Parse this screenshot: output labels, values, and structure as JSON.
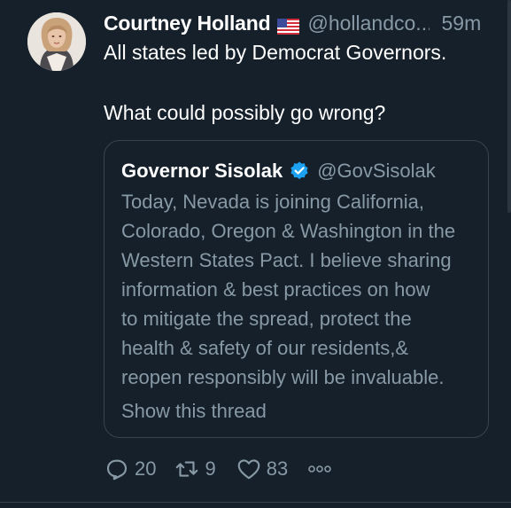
{
  "tweet": {
    "author_name": "Courtney Holland",
    "author_flag": "us-flag-icon",
    "author_handle": "@hollandco...",
    "time_ago": "59m",
    "text_line1": "All states led by Democrat Governors.",
    "text_line2": "What could possibly go wrong?"
  },
  "quote": {
    "author_name": "Governor Sisolak",
    "verified": true,
    "author_handle": "@GovSisolak",
    "body_lines": [
      "Today, Nevada is joining California,",
      "Colorado, Oregon & Washington in the",
      "Western States Pact. I believe sharing",
      "information & best practices on how",
      "to mitigate the spread, protect the",
      "health & safety of our residents,&",
      "reopen responsibly  will be invaluable."
    ],
    "show_thread": "Show this thread"
  },
  "actions": {
    "reply_count": "20",
    "retweet_count": "9",
    "like_count": "83",
    "more_icon": "more-icon"
  },
  "colors": {
    "background": "#15202b",
    "secondary_text": "#8899a6",
    "border": "#38444d",
    "verified": "#1da1f2"
  }
}
